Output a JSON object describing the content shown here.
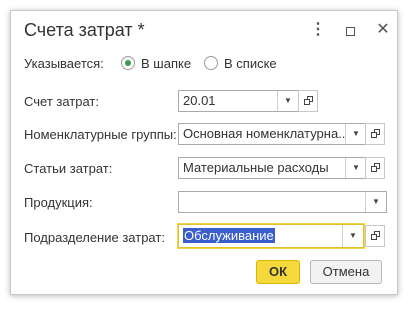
{
  "window": {
    "title": "Счета затрат *"
  },
  "placement": {
    "label": "Указывается:",
    "options": [
      {
        "label": "В шапке",
        "selected": true
      },
      {
        "label": "В списке",
        "selected": false
      }
    ]
  },
  "fields": {
    "account": {
      "label": "Счет затрат:",
      "value": "20.01"
    },
    "nomenclature_groups": {
      "label": "Номенклатурные группы:",
      "value": "Основная номенклатурна..."
    },
    "cost_items": {
      "label": "Статьи затрат:",
      "value": "Материальные расходы"
    },
    "products": {
      "label": "Продукция:",
      "value": ""
    },
    "department": {
      "label": "Подразделение затрат:",
      "value": "Обслуживание"
    }
  },
  "buttons": {
    "ok": "ОК",
    "cancel": "Отмена"
  },
  "colors": {
    "accent_yellow": "#f5d83b",
    "radio_green": "#3a9b4a",
    "selection_blue": "#3a5fcd"
  }
}
